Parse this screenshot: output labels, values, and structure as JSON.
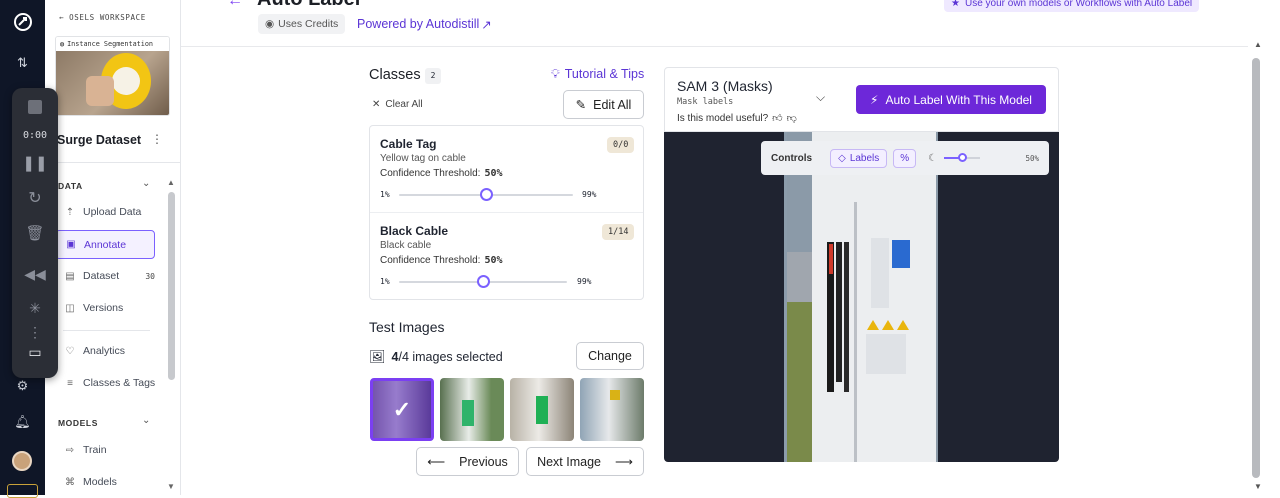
{
  "topbar": {
    "page_title": "Auto Label",
    "uses_credits": "Uses Credits",
    "powered_by": "Powered by Autodistill",
    "promo": "Use your own models or Workflows with Auto Label"
  },
  "recorder": {
    "time": "0:00"
  },
  "sidebar": {
    "workspace": "OSELS WORKSPACE",
    "project_type": "Instance Segmentation",
    "project_name": "Surge Dataset",
    "data_section": "DATA",
    "models_section": "MODELS",
    "items": [
      {
        "label": "Upload Data"
      },
      {
        "label": "Annotate"
      },
      {
        "label": "Dataset",
        "count": "30"
      },
      {
        "label": "Versions"
      },
      {
        "label": "Analytics"
      },
      {
        "label": "Classes & Tags"
      },
      {
        "label": "Train"
      },
      {
        "label": "Models"
      }
    ]
  },
  "classes": {
    "title": "Classes",
    "count": "2",
    "tutorial": "Tutorial & Tips",
    "clear_all": "Clear All",
    "edit_all": "Edit All",
    "list": [
      {
        "name": "Cable Tag",
        "prompt": "Yellow tag on cable",
        "threshold_label": "Confidence Threshold:",
        "threshold": "50%",
        "min": "1%",
        "max": "99%",
        "badge": "0/0",
        "level": 0.5
      },
      {
        "name": "Black Cable",
        "prompt": "Black cable",
        "threshold_label": "Confidence Threshold:",
        "threshold": "50%",
        "min": "1%",
        "max": "99%",
        "badge": "1/14",
        "level": 0.5
      }
    ]
  },
  "test_images": {
    "title": "Test Images",
    "selected_count": "4",
    "selected_total": "/4 images selected",
    "change": "Change",
    "previous": "Previous",
    "next": "Next Image"
  },
  "model": {
    "name": "SAM 3 (Masks)",
    "subtitle": "Mask labels",
    "useful": "Is this model useful?",
    "auto_label_btn": "Auto Label With This Model"
  },
  "viewer": {
    "controls": "Controls",
    "labels": "Labels",
    "percent": "%",
    "opacity": "50%",
    "opacity_level": 0.5
  },
  "colors": {
    "accent": "#7b3ff2",
    "purple_btn": "#6d28d9",
    "link": "#5b35d5"
  }
}
